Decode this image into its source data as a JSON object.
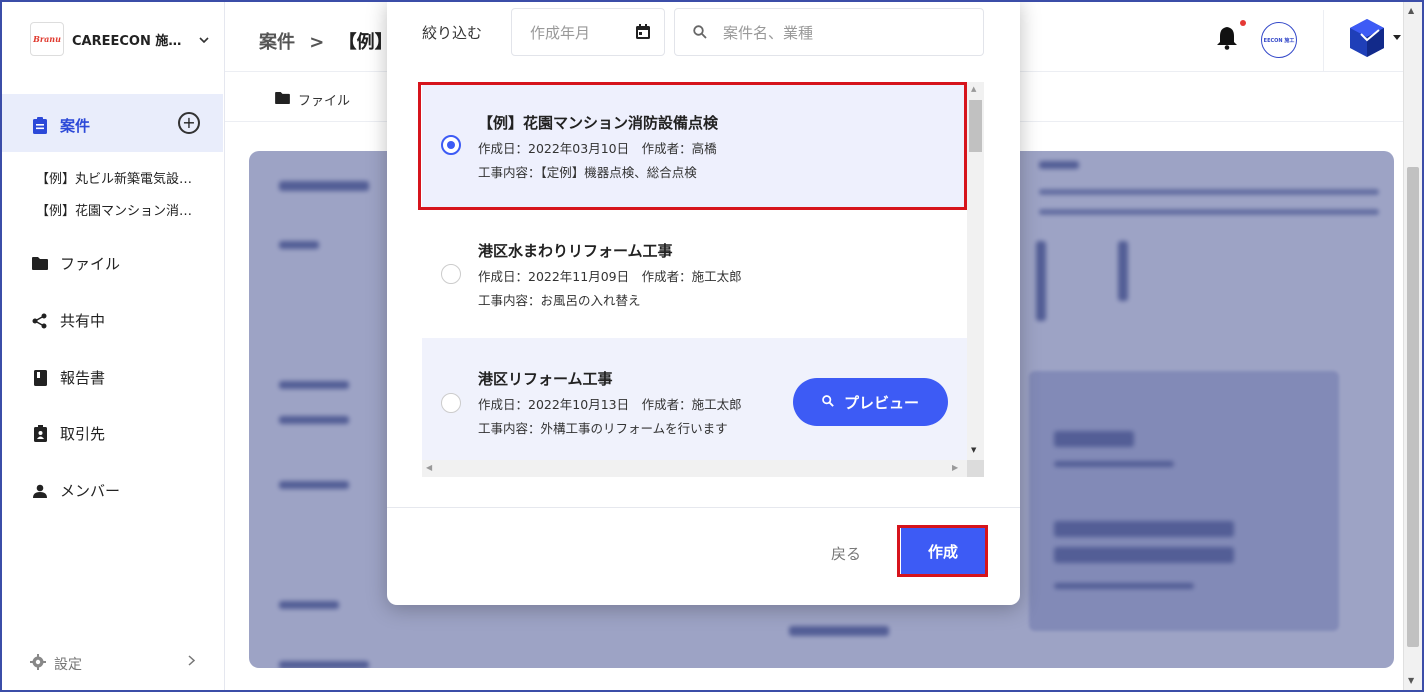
{
  "app": {
    "brand_logo_text": "Branu",
    "brand_name": "CAREECON 施…",
    "company_avatar_text": "EECON 施工"
  },
  "sidebar": {
    "active_item": "案件",
    "items": [
      {
        "label": "案件",
        "icon": "clipboard-icon"
      },
      {
        "label": "ファイル",
        "icon": "folder-icon"
      },
      {
        "label": "共有中",
        "icon": "share-icon"
      },
      {
        "label": "報告書",
        "icon": "book-icon"
      },
      {
        "label": "取引先",
        "icon": "badge-icon"
      },
      {
        "label": "メンバー",
        "icon": "person-icon"
      }
    ],
    "recent_projects": [
      "【例】丸ビル新築電気設…",
      "【例】花園マンション消…"
    ],
    "settings_label": "設定"
  },
  "header": {
    "breadcrumb_root": "案件",
    "breadcrumb_sep": ">",
    "breadcrumb_current": "【例】"
  },
  "tabs": {
    "files_label": "ファイル"
  },
  "modal": {
    "filter_label": "絞り込む",
    "date_placeholder": "作成年月",
    "search_placeholder": "案件名、業種",
    "templates": [
      {
        "title": "【例】花園マンション消防設備点検",
        "meta_line1": "作成日：2022年03月10日　作成者：高橋",
        "meta_line2": "工事内容：【定例】機器点検、総合点検",
        "selected": true
      },
      {
        "title": "港区水まわりリフォーム工事",
        "meta_line1": "作成日：2022年11月09日　作成者：施工太郎",
        "meta_line2": "工事内容：お風呂の入れ替え",
        "selected": false
      },
      {
        "title": "港区リフォーム工事",
        "meta_line1": "作成日：2022年10月13日　作成者：施工太郎",
        "meta_line2": "工事内容：外構工事のリフォームを行います",
        "selected": false
      }
    ],
    "preview_label": "プレビュー",
    "back_label": "戻る",
    "create_label": "作成"
  },
  "colors": {
    "accent": "#3d5bf5",
    "highlight": "#d6141c",
    "active_nav_bg": "#e9edfb"
  }
}
